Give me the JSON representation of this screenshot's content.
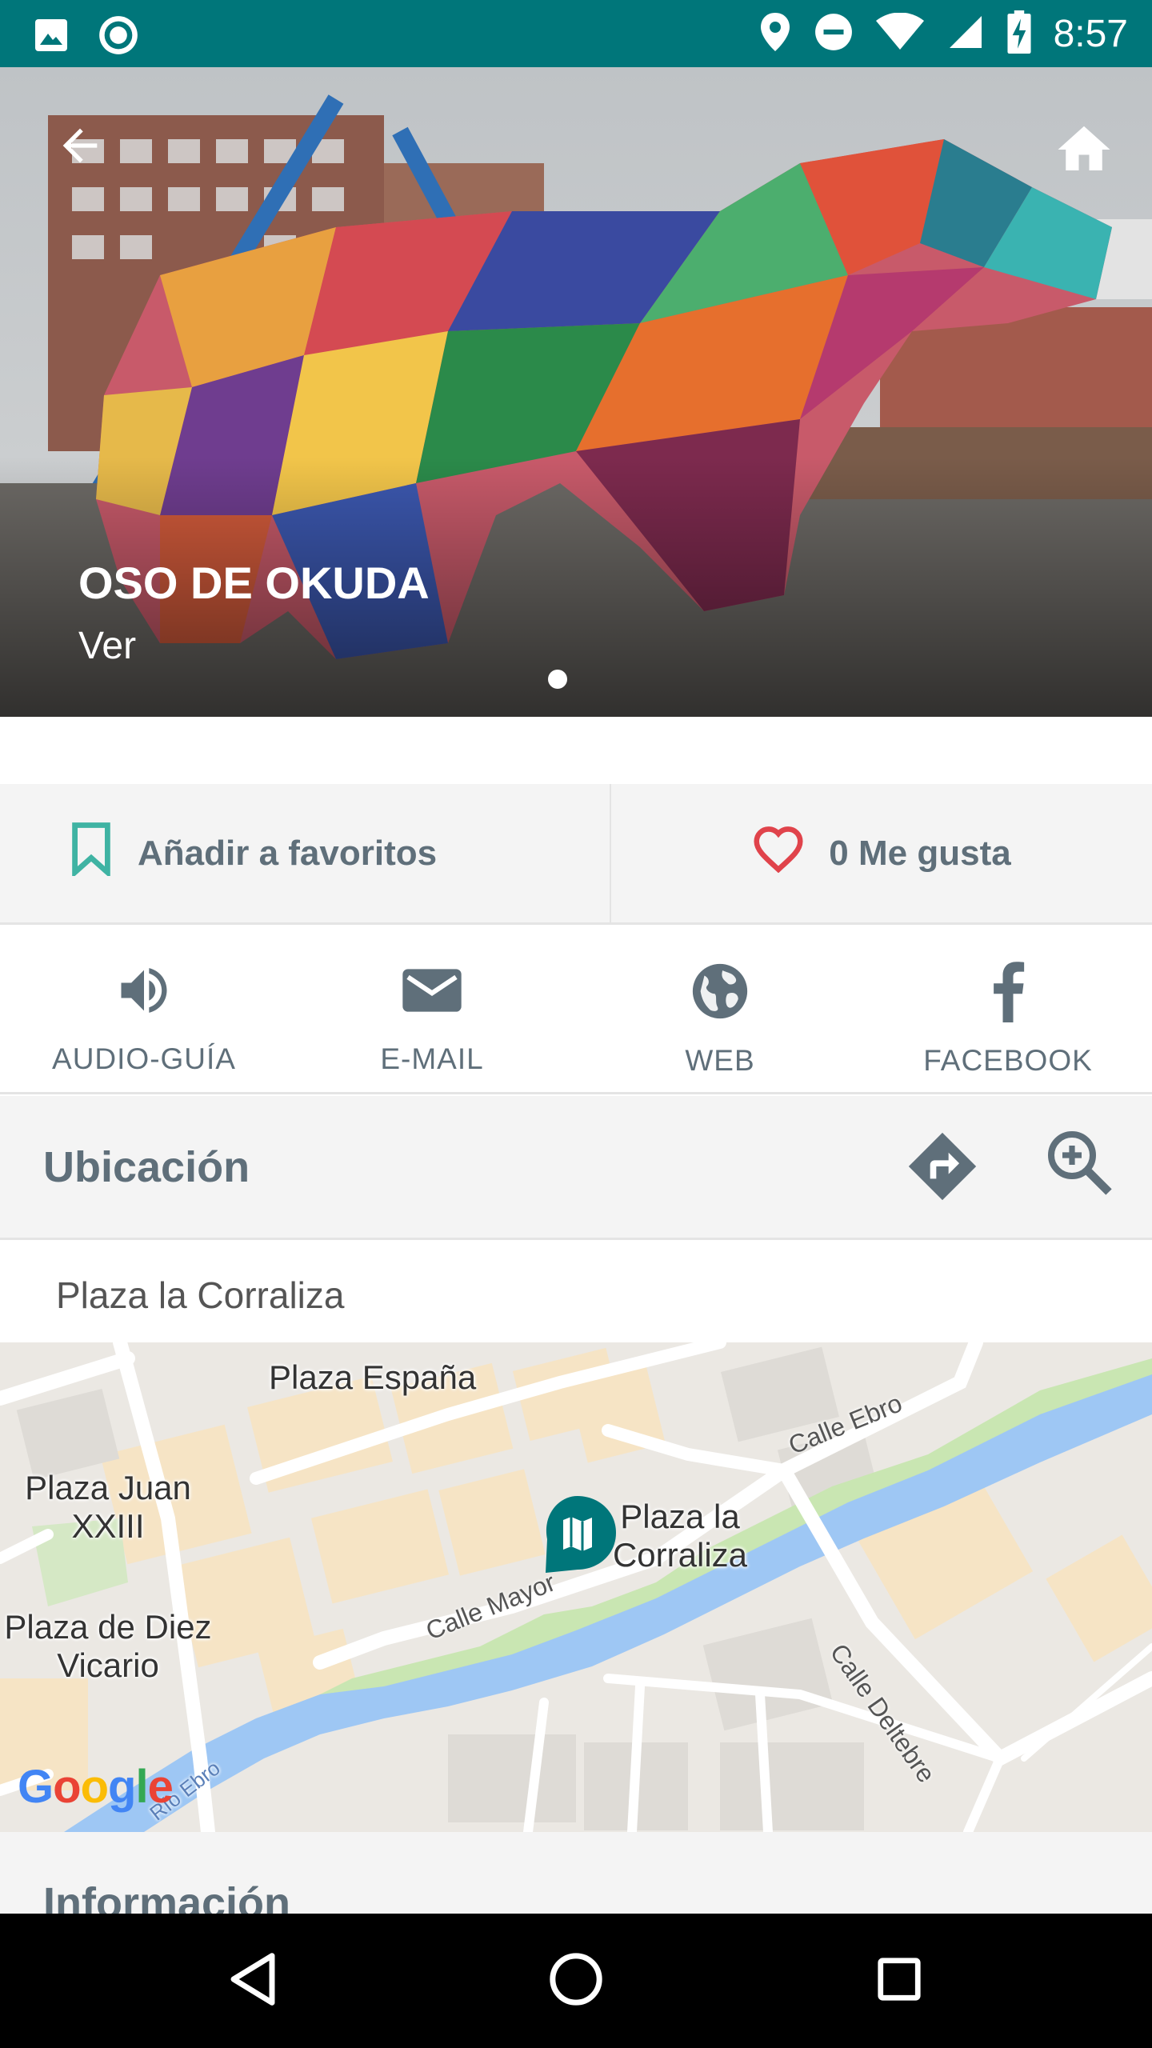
{
  "status_bar": {
    "time": "8:57",
    "icons": [
      "image-icon",
      "record-icon",
      "location-icon",
      "do-not-disturb-icon",
      "wifi-icon",
      "signal-icon",
      "battery-charging-icon"
    ]
  },
  "hero": {
    "title": "OSO DE OKUDA",
    "subtitle": "Ver",
    "pager_current": 1,
    "pager_total": 1
  },
  "favorites": {
    "add_label": "Añadir a favoritos",
    "likes_label": "0 Me gusta"
  },
  "actions": [
    {
      "label": "AUDIO-GUÍA",
      "icon": "speaker-icon"
    },
    {
      "label": "E-MAIL",
      "icon": "mail-icon"
    },
    {
      "label": "WEB",
      "icon": "globe-icon"
    },
    {
      "label": "FACEBOOK",
      "icon": "facebook-icon"
    }
  ],
  "location": {
    "title": "Ubicación",
    "address": "Plaza la Corraliza"
  },
  "map": {
    "labels": {
      "plaza_espana": "Plaza España",
      "plaza_juan": "Plaza Juan XXIII",
      "plaza_corraliza": "Plaza la Corraliza",
      "plaza_diez": "Plaza de Diez Vicario",
      "calle_ebro": "Calle Ebro",
      "calle_mayor": "Calle Mayor",
      "calle_deltebre": "Calle Deltebre",
      "rio_ebro": "Río Ebro"
    },
    "attribution": "Google"
  },
  "info": {
    "title": "Información"
  },
  "colors": {
    "primary": "#00767a",
    "text_gray": "#5f6f7a",
    "heart_red": "#e0434b",
    "water": "#9ec7f4",
    "building_tan": "#f6e4c5"
  }
}
